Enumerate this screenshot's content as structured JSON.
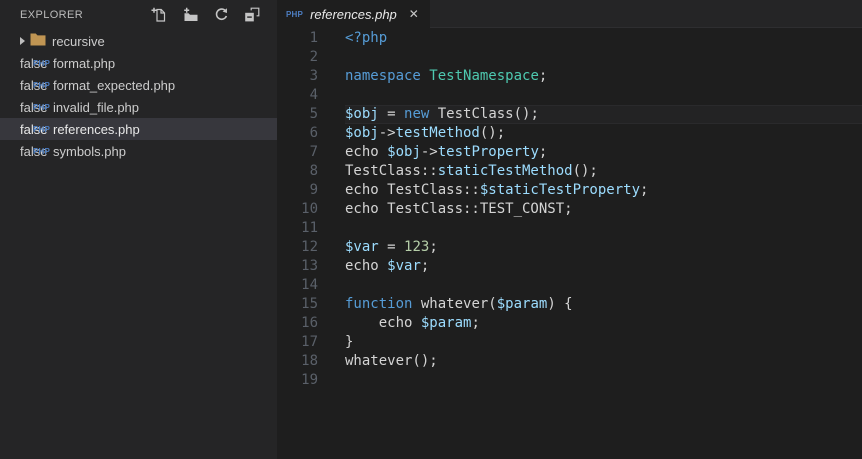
{
  "sidebar": {
    "header": {
      "title": "EXPLORER",
      "actions": [
        {
          "name": "new-file",
          "icon": "new-file-icon"
        },
        {
          "name": "new-folder",
          "icon": "new-folder-icon"
        },
        {
          "name": "refresh",
          "icon": "refresh-icon"
        },
        {
          "name": "collapse-all",
          "icon": "collapse-all-icon"
        }
      ]
    },
    "files": [
      {
        "label": "recursive",
        "type": "folder",
        "expanded": false,
        "selected": false
      },
      {
        "label": "format.php",
        "type": "php",
        "selected": false
      },
      {
        "label": "format_expected.php",
        "type": "php",
        "selected": false
      },
      {
        "label": "invalid_file.php",
        "type": "php",
        "selected": false
      },
      {
        "label": "references.php",
        "type": "php",
        "selected": true
      },
      {
        "label": "symbols.php",
        "type": "php",
        "selected": false
      }
    ]
  },
  "tabs": [
    {
      "label": "references.php",
      "icon": "php-icon",
      "active": true,
      "preview_italic": true,
      "close_label": "✕"
    }
  ],
  "editor": {
    "language": "php",
    "active_line": 5,
    "lines": [
      {
        "num": 1,
        "tokens": [
          [
            "k",
            "<?php"
          ]
        ]
      },
      {
        "num": 2,
        "tokens": []
      },
      {
        "num": 3,
        "tokens": [
          [
            "k",
            "namespace"
          ],
          [
            "d",
            " "
          ],
          [
            "t",
            "TestNamespace"
          ],
          [
            "d",
            ";"
          ]
        ]
      },
      {
        "num": 4,
        "tokens": []
      },
      {
        "num": 5,
        "tokens": [
          [
            "v",
            "$obj"
          ],
          [
            "d",
            " = "
          ],
          [
            "k",
            "new"
          ],
          [
            "d",
            " TestClass();"
          ]
        ]
      },
      {
        "num": 6,
        "tokens": [
          [
            "v",
            "$obj"
          ],
          [
            "d",
            "->"
          ],
          [
            "v",
            "testMethod"
          ],
          [
            "d",
            "();"
          ]
        ]
      },
      {
        "num": 7,
        "tokens": [
          [
            "d",
            "echo "
          ],
          [
            "v",
            "$obj"
          ],
          [
            "d",
            "->"
          ],
          [
            "v",
            "testProperty"
          ],
          [
            "d",
            ";"
          ]
        ]
      },
      {
        "num": 8,
        "tokens": [
          [
            "d",
            "TestClass::"
          ],
          [
            "v",
            "staticTestMethod"
          ],
          [
            "d",
            "();"
          ]
        ]
      },
      {
        "num": 9,
        "tokens": [
          [
            "d",
            "echo TestClass::"
          ],
          [
            "v",
            "$staticTestProperty"
          ],
          [
            "d",
            ";"
          ]
        ]
      },
      {
        "num": 10,
        "tokens": [
          [
            "d",
            "echo TestClass::TEST_CONST;"
          ]
        ]
      },
      {
        "num": 11,
        "tokens": []
      },
      {
        "num": 12,
        "tokens": [
          [
            "v",
            "$var"
          ],
          [
            "d",
            " = "
          ],
          [
            "n",
            "123"
          ],
          [
            "d",
            ";"
          ]
        ]
      },
      {
        "num": 13,
        "tokens": [
          [
            "d",
            "echo "
          ],
          [
            "v",
            "$var"
          ],
          [
            "d",
            ";"
          ]
        ]
      },
      {
        "num": 14,
        "tokens": []
      },
      {
        "num": 15,
        "tokens": [
          [
            "k",
            "function"
          ],
          [
            "d",
            " whatever("
          ],
          [
            "v",
            "$param"
          ],
          [
            "d",
            ") {"
          ]
        ]
      },
      {
        "num": 16,
        "tokens": [
          [
            "d",
            "    echo "
          ],
          [
            "v",
            "$param"
          ],
          [
            "d",
            ";"
          ]
        ]
      },
      {
        "num": 17,
        "tokens": [
          [
            "d",
            "}"
          ]
        ]
      },
      {
        "num": 18,
        "tokens": [
          [
            "d",
            "whatever();"
          ]
        ]
      },
      {
        "num": 19,
        "tokens": []
      }
    ]
  },
  "colors": {
    "editor_bg": "#1e1e1e",
    "panel_bg": "#252526",
    "selected_row_bg": "#37373d",
    "keyword": "#569cd6",
    "variable": "#9cdcfe",
    "type": "#4ec9b0",
    "number": "#b5cea8",
    "default_text": "#d4d4d4",
    "line_number": "#5a6069",
    "php_icon_blue": "#4d7ec2",
    "folder_icon_tan": "#c09553"
  }
}
